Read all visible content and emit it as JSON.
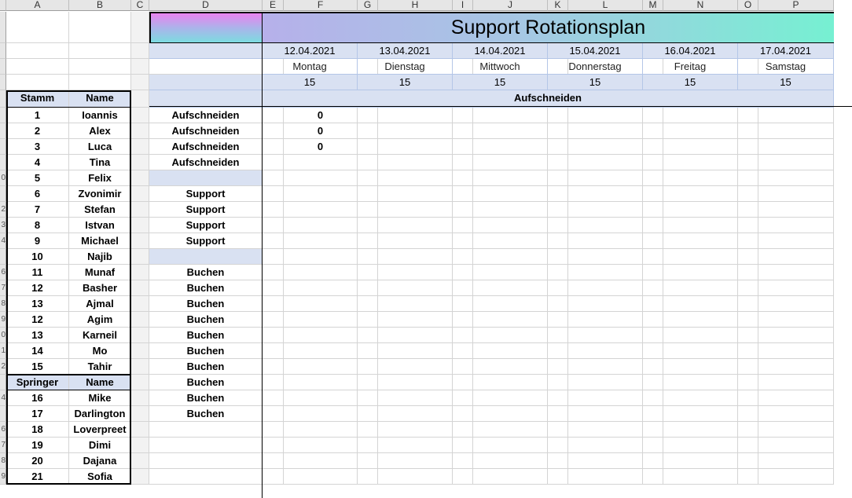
{
  "columns": [
    "A",
    "B",
    "C",
    "D",
    "E",
    "F",
    "G",
    "H",
    "I",
    "J",
    "K",
    "L",
    "M",
    "N",
    "O",
    "P"
  ],
  "title": "Support Rotationsplan",
  "dates": [
    "12.04.2021",
    "13.04.2021",
    "14.04.2021",
    "15.04.2021",
    "16.04.2021",
    "17.04.2021"
  ],
  "days": [
    "Montag",
    "Dienstag",
    "Mittwoch",
    "Donnerstag",
    "Freitag",
    "Samstag"
  ],
  "counts": [
    "15",
    "15",
    "15",
    "15",
    "15",
    "15"
  ],
  "section_label": "Aufschneiden",
  "headers": {
    "stamm": "Stamm",
    "name": "Name",
    "springer": "Springer"
  },
  "rows": [
    {
      "row": "",
      "num": "1",
      "name": "Ioannis",
      "task": "Aufschneiden",
      "val": "0"
    },
    {
      "row": "",
      "num": "2",
      "name": "Alex",
      "task": "Aufschneiden",
      "val": "0"
    },
    {
      "row": "",
      "num": "3",
      "name": "Luca",
      "task": "Aufschneiden",
      "val": "0"
    },
    {
      "row": "",
      "num": "4",
      "name": "Tina",
      "task": "Aufschneiden",
      "val": ""
    },
    {
      "row": "0",
      "num": "5",
      "name": "Felix",
      "task": "",
      "val": ""
    },
    {
      "row": "",
      "num": "6",
      "name": "Zvonimir",
      "task": "Support",
      "val": ""
    },
    {
      "row": "2",
      "num": "7",
      "name": "Stefan",
      "task": "Support",
      "val": ""
    },
    {
      "row": "3",
      "num": "8",
      "name": "Istvan",
      "task": "Support",
      "val": ""
    },
    {
      "row": "4",
      "num": "9",
      "name": "Michael",
      "task": "Support",
      "val": ""
    },
    {
      "row": "",
      "num": "10",
      "name": "Najib",
      "task": "",
      "val": ""
    },
    {
      "row": "6",
      "num": "11",
      "name": "Munaf",
      "task": "Buchen",
      "val": ""
    },
    {
      "row": "7",
      "num": "12",
      "name": "Basher",
      "task": "Buchen",
      "val": ""
    },
    {
      "row": "8",
      "num": "13",
      "name": "Ajmal",
      "task": "Buchen",
      "val": ""
    },
    {
      "row": "9",
      "num": "12",
      "name": "Agim",
      "task": "Buchen",
      "val": ""
    },
    {
      "row": "0",
      "num": "13",
      "name": "Karneil",
      "task": "Buchen",
      "val": ""
    },
    {
      "row": "1",
      "num": "14",
      "name": "Mo",
      "task": "Buchen",
      "val": ""
    },
    {
      "row": "2",
      "num": "15",
      "name": "Tahir",
      "task": "Buchen",
      "val": ""
    },
    {
      "row": "",
      "num": "Springer",
      "name": "Name",
      "task": "Buchen",
      "val": "",
      "header": true
    },
    {
      "row": "4",
      "num": "16",
      "name": "Mike",
      "task": "Buchen",
      "val": ""
    },
    {
      "row": "",
      "num": "17",
      "name": "Darlington",
      "task": "Buchen",
      "val": ""
    },
    {
      "row": "6",
      "num": "18",
      "name": "Loverpreet",
      "task": "",
      "val": ""
    },
    {
      "row": "7",
      "num": "19",
      "name": "Dimi",
      "task": "",
      "val": ""
    },
    {
      "row": "8",
      "num": "20",
      "name": "Dajana",
      "task": "",
      "val": ""
    },
    {
      "row": "9",
      "num": "21",
      "name": "Sofia",
      "task": "",
      "val": ""
    }
  ],
  "colors": {
    "header_blue": "#d9e1f2",
    "grid": "#d4d4d4",
    "gray_column": "#f2f2f2"
  }
}
